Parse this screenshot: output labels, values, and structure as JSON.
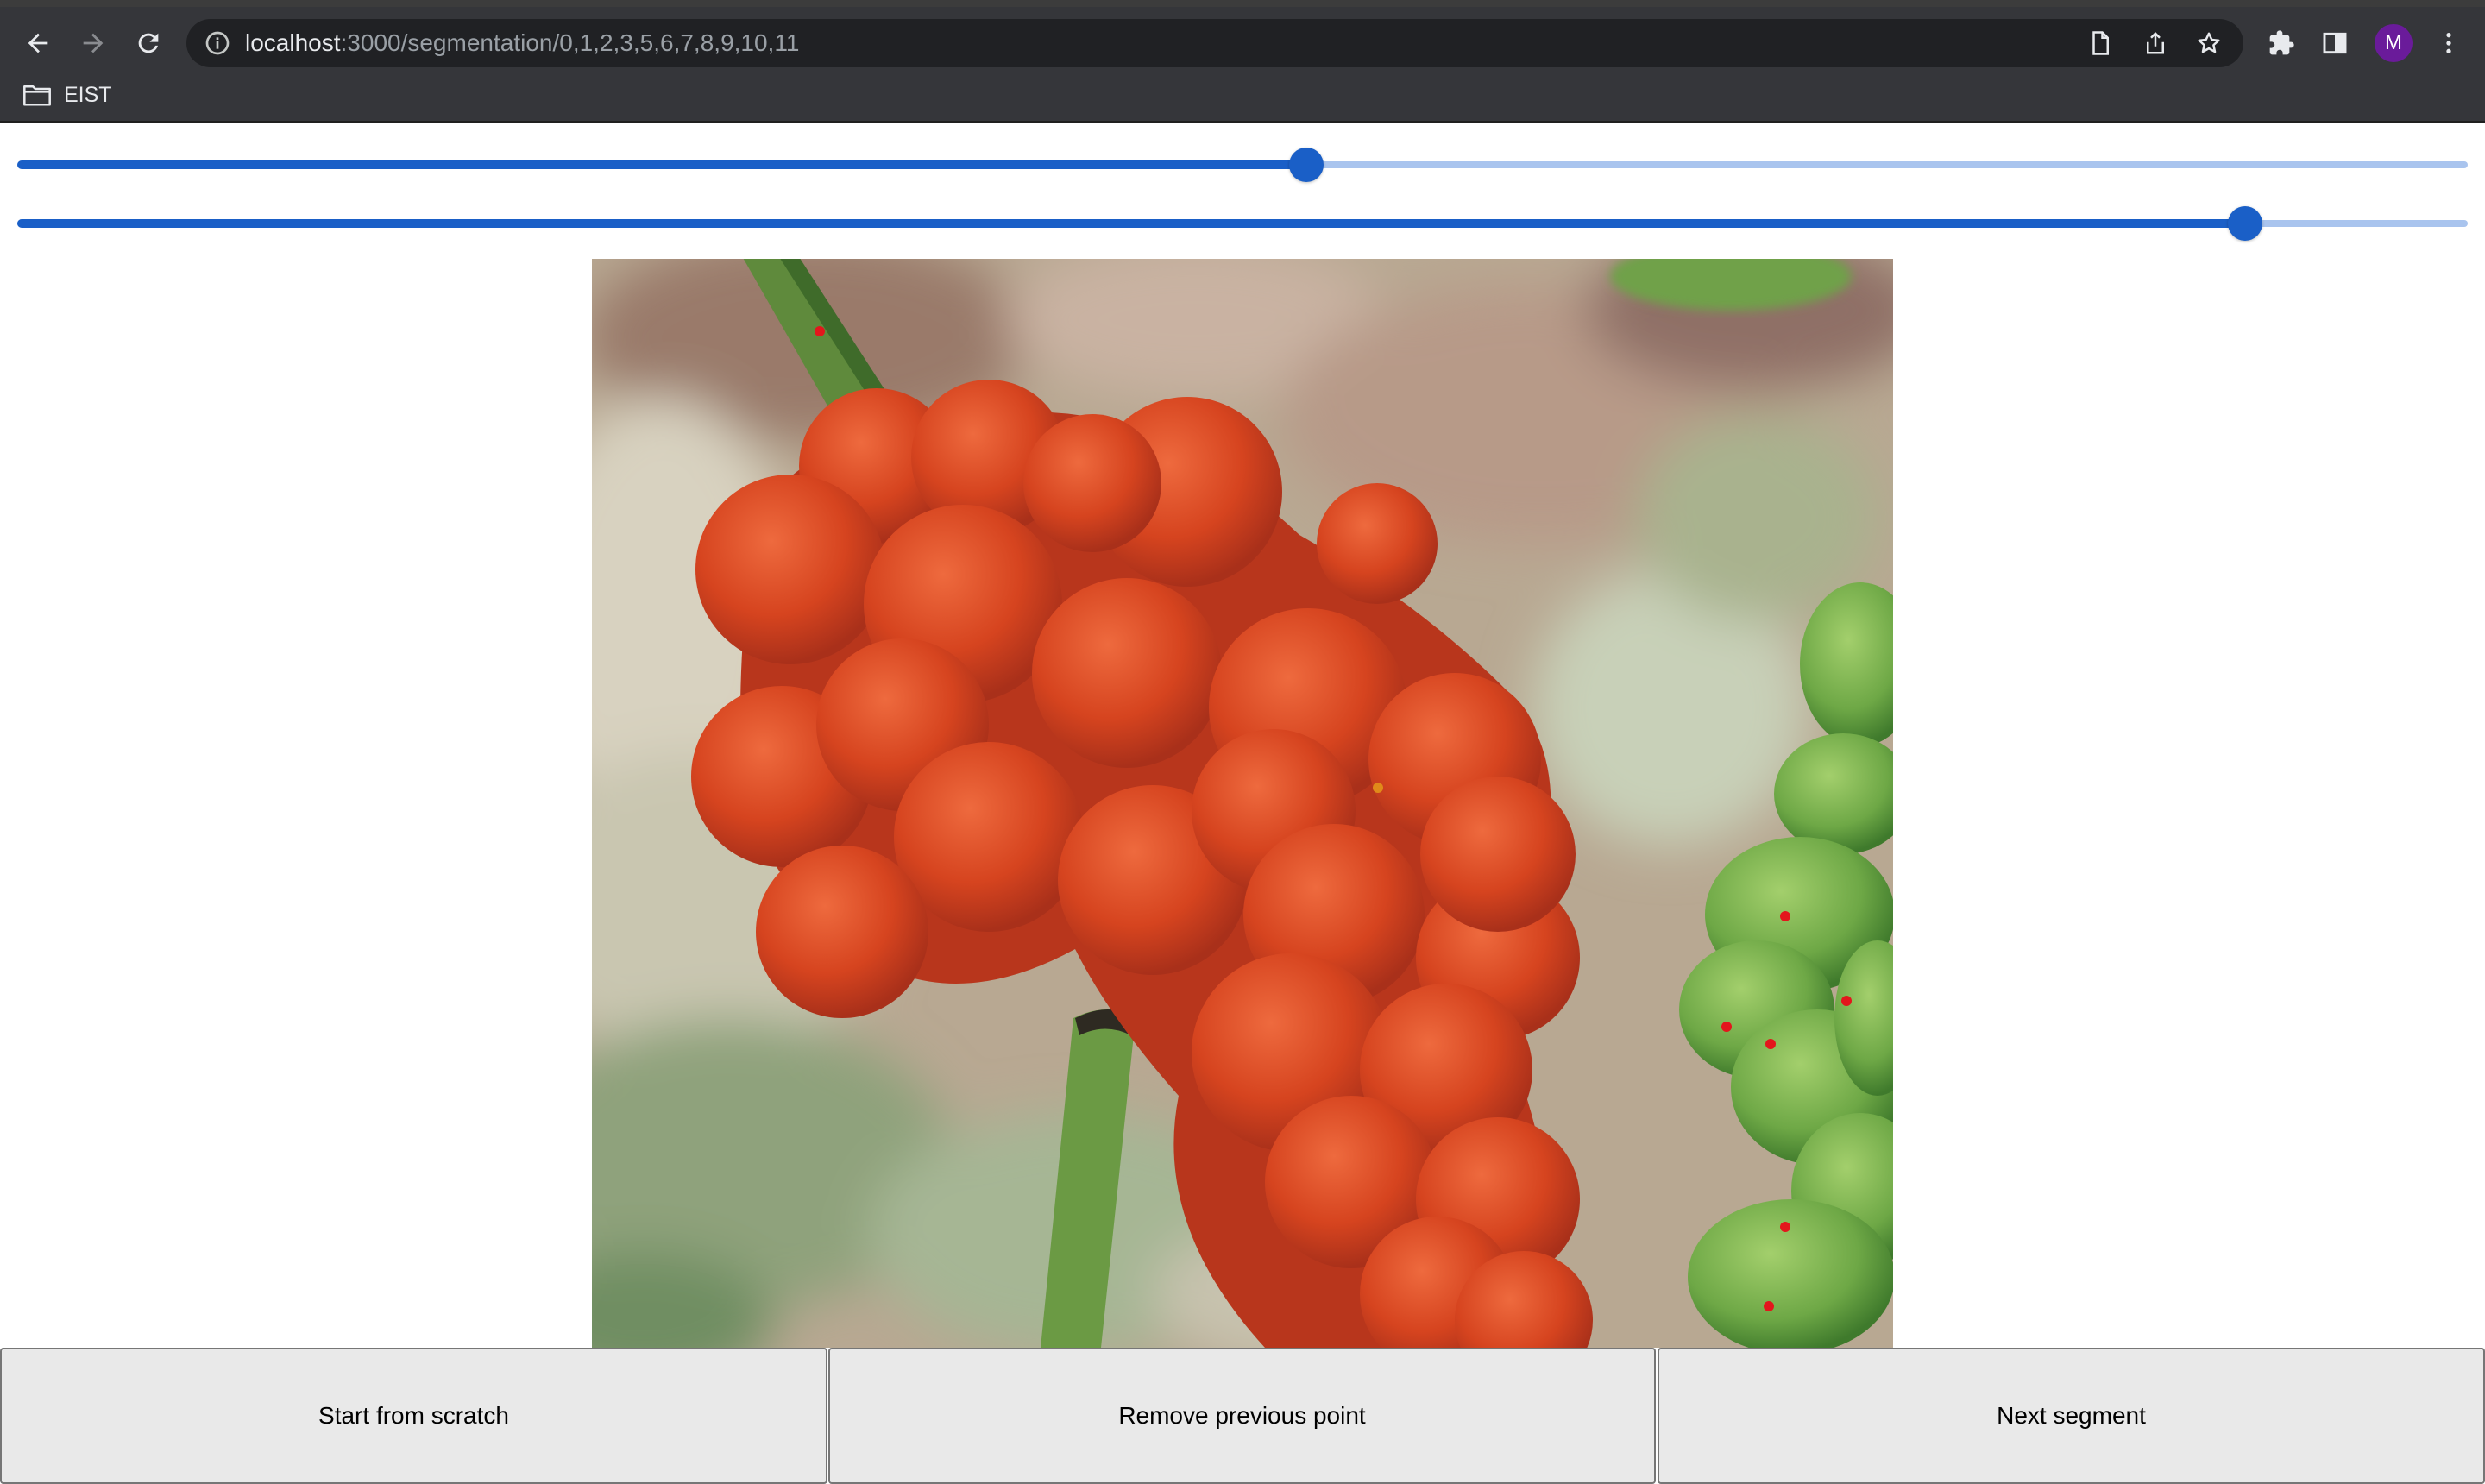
{
  "browser": {
    "url_host": "localhost",
    "url_path": ":3000/segmentation/0,1,2,3,5,6,7,8,9,10,11",
    "profile_initial": "M",
    "bookmark_label": "EIST"
  },
  "sliders": [
    {
      "name": "slider-1",
      "value_percent": 52.6
    },
    {
      "name": "slider-2",
      "value_percent": 90.9
    }
  ],
  "image": {
    "description_icon": "image-canvas",
    "marker_colors": {
      "negative": "#e3161c",
      "positive": "#e08a1a"
    },
    "mask_color": "#d9431f"
  },
  "buttons": {
    "start_from_scratch": "Start from scratch",
    "remove_previous_point": "Remove previous point",
    "next_segment": "Next segment"
  }
}
